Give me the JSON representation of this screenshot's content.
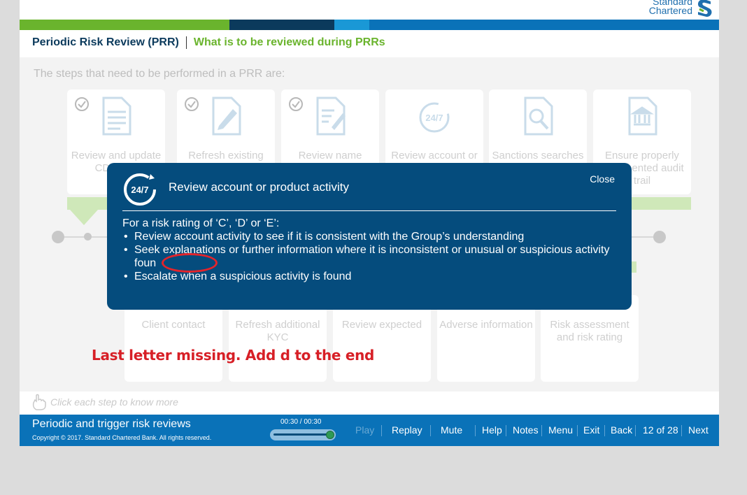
{
  "brand": {
    "name_line1": "Standard",
    "name_line2": "Chartered",
    "color": "#1f6fae"
  },
  "stripe_colors": [
    "#6ab42d",
    "#0b3a5c",
    "#1a98d6",
    "#0a72b8"
  ],
  "header": {
    "title": "Periodic Risk Review (PRR)",
    "subtitle": "What is to be reviewed during PRRs"
  },
  "intro": "The steps that need to be performed in a PRR are:",
  "top_steps": [
    {
      "label": "Review and update CDD info",
      "icon": "document-icon",
      "checked": true
    },
    {
      "label": "Refresh existing ID&V information",
      "icon": "edit-document-icon",
      "checked": true
    },
    {
      "label": "Review name screening results",
      "icon": "edit-list-icon",
      "checked": true
    },
    {
      "label": "Review account or product",
      "icon": "24-7-icon",
      "checked": false
    },
    {
      "label": "Sanctions searches",
      "icon": "search-document-icon",
      "checked": false
    },
    {
      "label": "Ensure properly documented audit trail",
      "icon": "bank-document-icon",
      "checked": false
    }
  ],
  "bottom_steps": [
    {
      "label": "Client contact"
    },
    {
      "label": "Refresh additional KYC"
    },
    {
      "label": "Review expected"
    },
    {
      "label": "Adverse information"
    },
    {
      "label": "Risk assessment and risk rating"
    }
  ],
  "annotation": "Last letter missing. Add d to the end",
  "popup": {
    "title": "Review account or product activity",
    "close": "Close",
    "intro": "For a risk rating of ‘C’, ‘D’ or ‘E’:",
    "bullets": [
      "Review account activity to see if it is consistent with the Group’s understanding",
      "Seek explanations or further information where it is inconsistent or unusual or suspicious activity foun",
      "Escalate when a suspicious activity is found"
    ]
  },
  "hint": "Click each step to know more",
  "footer": {
    "title": "Periodic and trigger risk reviews",
    "copyright": "Copyright © 2017. Standard Chartered Bank. All rights reserved.",
    "timecode": "00:30 / 00:30",
    "progress": 1.0,
    "buttons": {
      "play": "Play",
      "replay": "Replay",
      "mute": "Mute",
      "help": "Help",
      "notes": "Notes",
      "menu": "Menu",
      "exit": "Exit",
      "back": "Back",
      "page": "12 of 28",
      "next": "Next"
    }
  }
}
